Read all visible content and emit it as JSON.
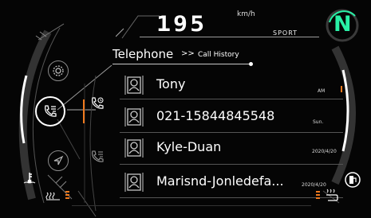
{
  "header": {
    "speed": "195",
    "speed_unit": "km/h",
    "ride_mode": "SPORT",
    "gear": "N"
  },
  "colors": {
    "accent_orange": "#f07a1e",
    "gear_green": "#29f0a6",
    "text": "#ffffff",
    "background": "#050505"
  },
  "screen": {
    "title": "Telephone",
    "breadcrumb_separator": ">>",
    "breadcrumb": "Call History"
  },
  "left_menu": [
    {
      "icon": "settings-gear-icon"
    },
    {
      "icon": "phone-list-icon",
      "active": true
    },
    {
      "icon": "navigation-arrow-icon"
    }
  ],
  "tabs": [
    {
      "icon": "call-history-icon",
      "active": true
    },
    {
      "icon": "contacts-list-icon",
      "active": false
    }
  ],
  "call_history": [
    {
      "name": "Tony",
      "time": "AM"
    },
    {
      "name": "021-15844845548",
      "time": "Sun."
    },
    {
      "name": "Kyle-Duan",
      "time": "2020/4/20"
    },
    {
      "name": "Marisnd-Jonledefa...",
      "time": "2020/4/20"
    }
  ],
  "indicators": {
    "left_bottom": [
      "coolant-temp-icon",
      "seat-heat-icon"
    ],
    "right_bottom": [
      "fuel-icon",
      "grip-heat-icon"
    ]
  }
}
